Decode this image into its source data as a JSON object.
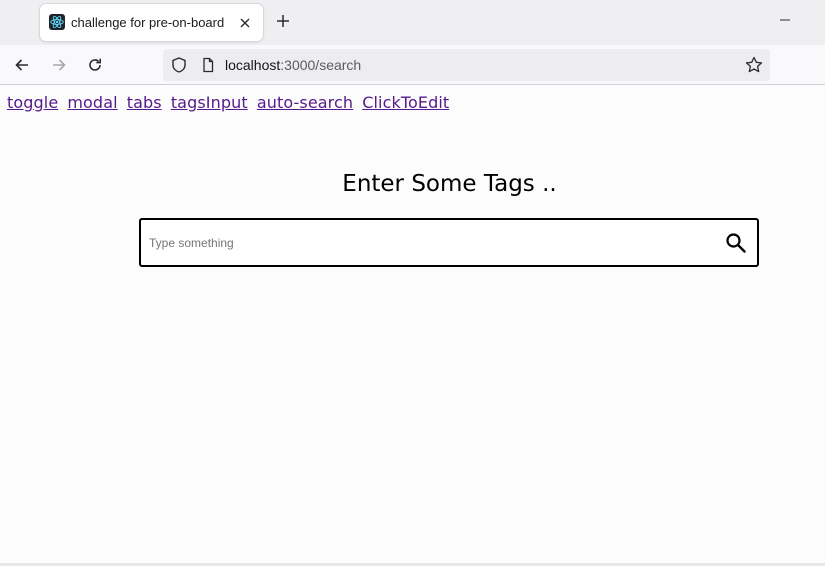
{
  "browser": {
    "tab": {
      "title": "challenge for pre-on-board",
      "favicon": "react-logo-icon"
    },
    "url": {
      "host": "localhost",
      "path": ":3000/search"
    }
  },
  "page": {
    "nav_links": [
      {
        "label": "toggle"
      },
      {
        "label": "modal"
      },
      {
        "label": "tabs"
      },
      {
        "label": "tagsInput"
      },
      {
        "label": "auto-search"
      },
      {
        "label": "ClickToEdit"
      }
    ],
    "heading": "Enter Some Tags ..",
    "search": {
      "value": "",
      "placeholder": "Type something",
      "icon": "search-icon"
    }
  },
  "colors": {
    "link_visited": "#551a8b",
    "page_background": "#fdfcfd",
    "search_border": "#000000"
  }
}
